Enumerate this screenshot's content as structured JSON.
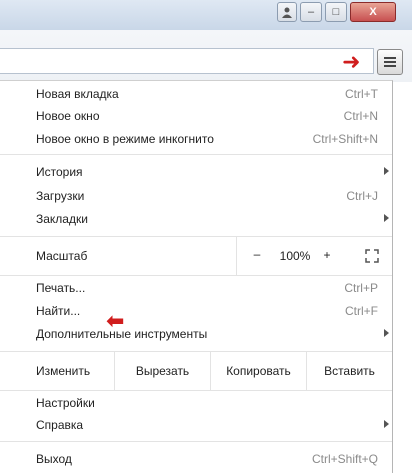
{
  "window": {
    "buttons": {
      "user_icon": "user-icon",
      "minimize": "–",
      "maximize": "□",
      "close": "X"
    }
  },
  "menu": {
    "new_tab": {
      "label": "Новая вкладка",
      "shortcut": "Ctrl+T"
    },
    "new_window": {
      "label": "Новое окно",
      "shortcut": "Ctrl+N"
    },
    "incognito": {
      "label": "Новое окно в режиме инкогнито",
      "shortcut": "Ctrl+Shift+N"
    },
    "history": {
      "label": "История"
    },
    "downloads": {
      "label": "Загрузки",
      "shortcut": "Ctrl+J"
    },
    "bookmarks": {
      "label": "Закладки"
    },
    "zoom": {
      "label": "Масштаб",
      "minus": "–",
      "value": "100%",
      "plus": "+"
    },
    "print": {
      "label": "Печать...",
      "shortcut": "Ctrl+P"
    },
    "find": {
      "label": "Найти...",
      "shortcut": "Ctrl+F"
    },
    "more_tools": {
      "label": "Дополнительные инструменты"
    },
    "edit": {
      "label": "Изменить",
      "cut": "Вырезать",
      "copy": "Копировать",
      "paste": "Вставить"
    },
    "settings": {
      "label": "Настройки"
    },
    "help": {
      "label": "Справка"
    },
    "exit": {
      "label": "Выход",
      "shortcut": "Ctrl+Shift+Q"
    }
  },
  "colors": {
    "arrow": "#d01d1d"
  }
}
